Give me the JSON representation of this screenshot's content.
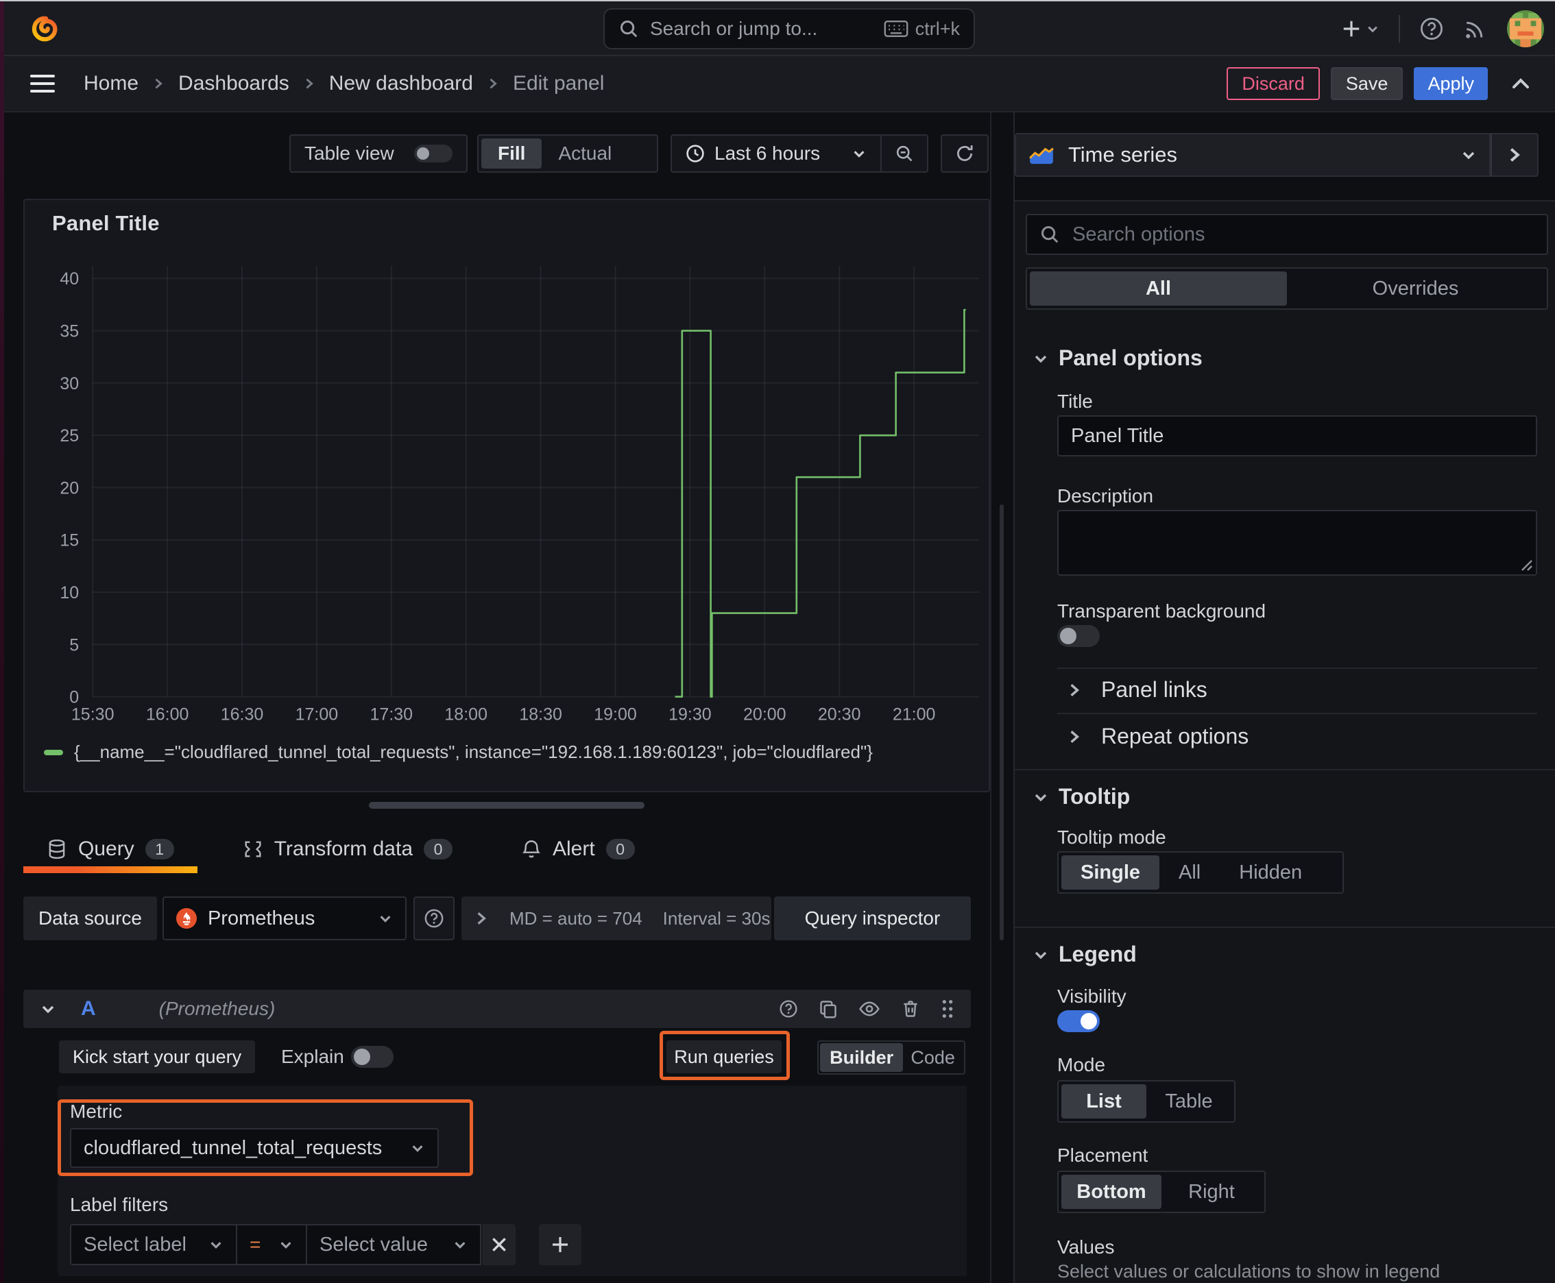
{
  "topbar": {
    "search_placeholder": "Search or jump to...",
    "search_shortcut": "ctrl+k"
  },
  "breadcrumb": {
    "items": [
      "Home",
      "Dashboards",
      "New dashboard"
    ],
    "current": "Edit panel",
    "separator": ">"
  },
  "actions": {
    "discard_label": "Discard",
    "save_label": "Save",
    "apply_label": "Apply"
  },
  "toolbar": {
    "table_view_label": "Table view",
    "fit_options": [
      "Fill",
      "Actual"
    ],
    "fit_selected": "Fill",
    "time_range_label": "Last 6 hours"
  },
  "panel": {
    "title": "Panel Title"
  },
  "chart_data": {
    "type": "line",
    "step": true,
    "title": "Panel Title",
    "xlabel": "",
    "ylabel": "",
    "ylim": [
      0,
      40
    ],
    "y_ticks": [
      0,
      5,
      10,
      15,
      20,
      25,
      30,
      35,
      40
    ],
    "x_start": "15:30",
    "x_tick_interval_min": 30,
    "x_ticks": [
      "15:30",
      "16:00",
      "16:30",
      "17:00",
      "17:30",
      "18:00",
      "18:30",
      "19:00",
      "19:30",
      "20:00",
      "20:30",
      "21:00"
    ],
    "x_max_min": 356,
    "grid": true,
    "legend_position": "bottom",
    "series": [
      {
        "name": "{__name__=\"cloudflared_tunnel_total_requests\", instance=\"192.168.1.189:60123\", job=\"cloudflared\"}",
        "color": "#73bf69",
        "points_min_value": [
          [
            234.0,
            0
          ],
          [
            236.8,
            0
          ],
          [
            236.8,
            35
          ],
          [
            248.3,
            35
          ],
          [
            248.3,
            0
          ],
          [
            248.8,
            0
          ],
          [
            248.8,
            8
          ],
          [
            282.8,
            8
          ],
          [
            282.8,
            21
          ],
          [
            308.3,
            21
          ],
          [
            308.3,
            25
          ],
          [
            322.7,
            25
          ],
          [
            322.7,
            31
          ],
          [
            350.2,
            31
          ],
          [
            350.2,
            37
          ],
          [
            350.8,
            37
          ]
        ]
      }
    ]
  },
  "tabs": [
    {
      "label": "Query",
      "count": "1",
      "active": true
    },
    {
      "label": "Transform data",
      "count": "0",
      "active": false
    },
    {
      "label": "Alert",
      "count": "0",
      "active": false
    }
  ],
  "datasource": {
    "label": "Data source",
    "value": "Prometheus",
    "stats_md": "MD = auto = 704",
    "stats_interval": "Interval = 30s",
    "inspector_label": "Query inspector"
  },
  "query": {
    "ref": "A",
    "ds_hint": "(Prometheus)",
    "kick_start_label": "Kick start your query",
    "explain_label": "Explain",
    "run_label": "Run queries",
    "mode_options": [
      "Builder",
      "Code"
    ],
    "mode_selected": "Builder",
    "metric_label": "Metric",
    "metric_value": "cloudflared_tunnel_total_requests",
    "label_filters_label": "Label filters",
    "select_label_placeholder": "Select label",
    "operator": "=",
    "select_value_placeholder": "Select value"
  },
  "sidebar": {
    "viz_name": "Time series",
    "search_placeholder": "Search options",
    "scope_options": [
      "All",
      "Overrides"
    ],
    "scope_selected": "All",
    "panel_options": {
      "header": "Panel options",
      "title_label": "Title",
      "title_value": "Panel Title",
      "description_label": "Description",
      "description_value": "",
      "transparent_label": "Transparent background",
      "transparent_on": false
    },
    "collapsed_sections": [
      "Panel links",
      "Repeat options"
    ],
    "tooltip": {
      "header": "Tooltip",
      "mode_label": "Tooltip mode",
      "mode_options": [
        "Single",
        "All",
        "Hidden"
      ],
      "mode_selected": "Single"
    },
    "legend": {
      "header": "Legend",
      "visibility_label": "Visibility",
      "visibility_on": true,
      "mode_label": "Mode",
      "mode_options": [
        "List",
        "Table"
      ],
      "mode_selected": "List",
      "placement_label": "Placement",
      "placement_options": [
        "Bottom",
        "Right"
      ],
      "placement_selected": "Bottom",
      "values_label": "Values",
      "values_hint": "Select values or calculations to show in legend"
    }
  },
  "annotations": {
    "color": "#e8622a",
    "highlighted": [
      "Run queries",
      "Metric"
    ]
  }
}
